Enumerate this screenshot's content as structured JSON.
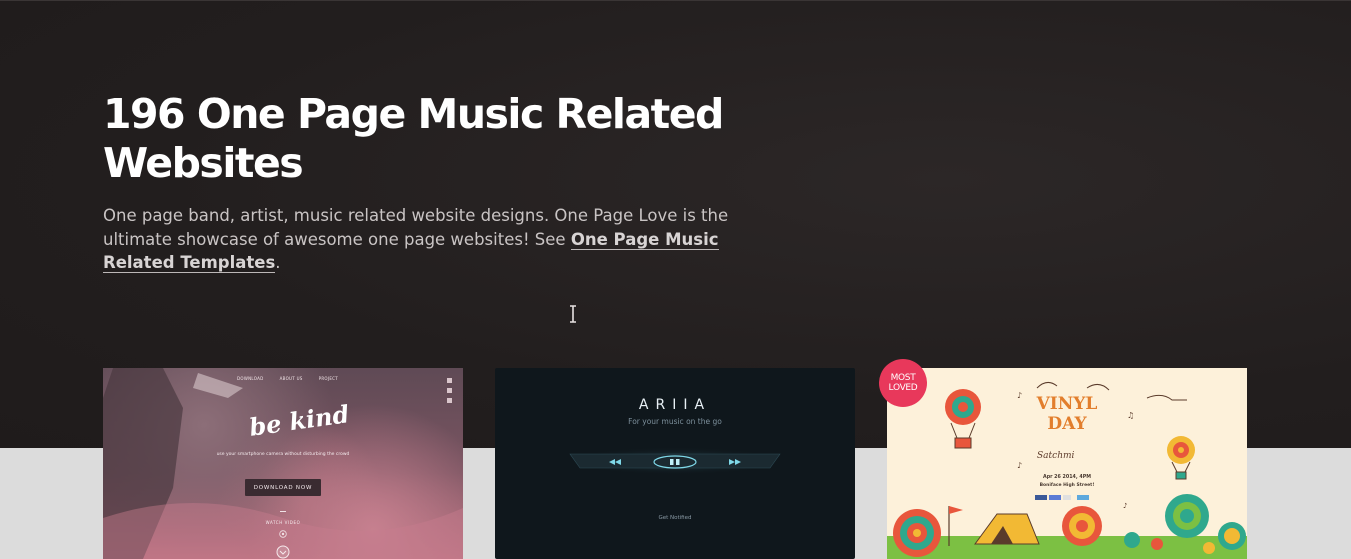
{
  "hero": {
    "title": "196 One Page Music Related Websites",
    "description_prefix": "One page band, artist, music related website designs. One Page Love is the ultimate showcase of awesome one page websites! See ",
    "templates_link": "One Page Music Related Templates",
    "description_suffix": "."
  },
  "cards": [
    {
      "nav": [
        "DOWNLOAD",
        "ABOUT US",
        "PROJECT"
      ],
      "logo": "be kind",
      "tagline": "use your smartphone camera without disturbing the crowd",
      "button": "DOWNLOAD NOW",
      "secondary": "WATCH VIDEO"
    },
    {
      "title": "ARIIA",
      "subtitle": "For your music on the go",
      "cta": "Get Notified"
    },
    {
      "badge_line1": "MOST",
      "badge_line2": "LOVED",
      "title_line1": "VINYL",
      "title_line2": "DAY",
      "by": "Satchmi",
      "date": "Apr 26 2014, 4PM",
      "address": "Boniface High Street!"
    }
  ],
  "colors": {
    "hero_bg": "#231f1f",
    "page_bg": "#dcdcdc",
    "badge": "#e8385b"
  }
}
